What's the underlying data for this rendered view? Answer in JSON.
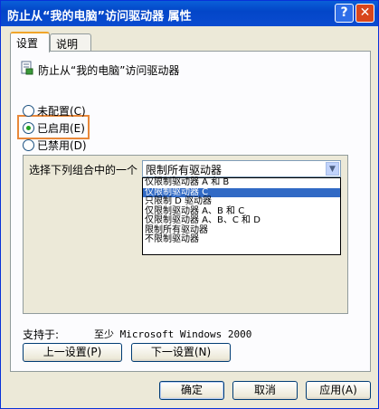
{
  "window": {
    "title": "防止从“我的电脑”访问驱动器 属性",
    "help_glyph": "?",
    "close_glyph": "✕"
  },
  "tabs": [
    {
      "label": "设置"
    },
    {
      "label": "说明"
    }
  ],
  "policy": {
    "title": "防止从“我的电脑”访问驱动器",
    "icon": "policy-document-icon"
  },
  "radios": [
    {
      "label": "未配置(C)",
      "selected": false
    },
    {
      "label": "已启用(E)",
      "selected": true
    },
    {
      "label": "已禁用(D)",
      "selected": false
    }
  ],
  "options": {
    "label": "选择下列组合中的一个",
    "selected_value": "限制所有驱动器",
    "items": [
      "仅限制驱动器 A 和 B",
      "仅限制驱动器 C",
      "只限制 D 驱动器",
      "仅限制驱动器 A、B 和 C",
      "仅限制驱动器 A、B、C 和 D",
      "限制所有驱动器",
      "不限制驱动器"
    ],
    "highlighted_index": 1
  },
  "support": {
    "label": "支持于:",
    "value": "至少 Microsoft Windows 2000"
  },
  "nav_buttons": {
    "prev": "上一设置(P)",
    "next": "下一设置(N)"
  },
  "dialog_buttons": {
    "ok": "确定",
    "cancel": "取消",
    "apply": "应用(A)"
  },
  "colors": {
    "title_bar": "#0a4bd0",
    "highlight": "#316ac5",
    "annotation_box": "#e8883a"
  }
}
